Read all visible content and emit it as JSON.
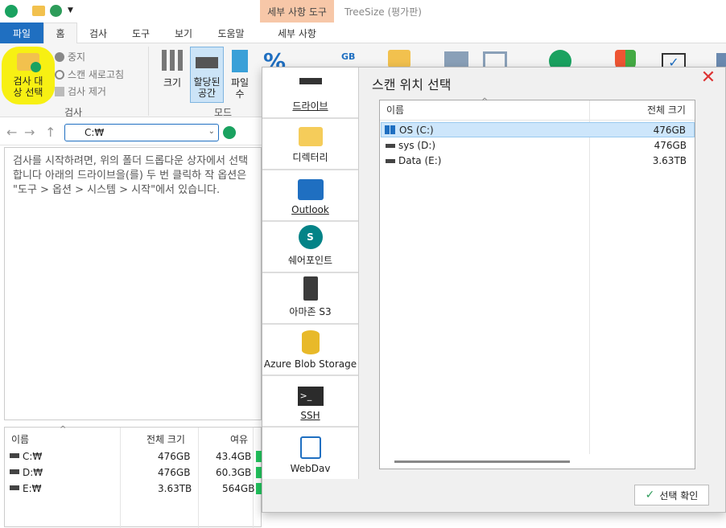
{
  "app": {
    "title": "TreeSize  (평가판)",
    "context_header": "세부 사항 도구"
  },
  "tabs": [
    "파일",
    "홈",
    "검사",
    "도구",
    "보기",
    "도움말",
    "세부 사항"
  ],
  "ribbon": {
    "select_target": "검사 대상 선택",
    "stop": "중지",
    "rescan": "스캔 새로고침",
    "remove": "검사 제거",
    "group_scan": "검사",
    "size": "크기",
    "allocated": "할당된 공간",
    "files": "파일 수",
    "group_mode": "모드",
    "gb": "GB"
  },
  "address": {
    "path": "C:₩"
  },
  "info_text": "검사를 시작하려면, 위의 폴더 드롭다운 상자에서 선택합니다 아래의 드라이브을(를) 두 번 클릭하 작 옵션은 \"도구 > 옵션 > 시스템 > 시작\"에서 있습니다.",
  "drive_list": {
    "headers": [
      "이름",
      "전체 크기",
      "여유"
    ],
    "rows": [
      {
        "name": "C:₩",
        "total": "476GB",
        "free": "43.4GB"
      },
      {
        "name": "D:₩",
        "total": "476GB",
        "free": "60.3GB"
      },
      {
        "name": "E:₩",
        "total": "3.63TB",
        "free": "564GB"
      }
    ]
  },
  "dialog": {
    "title": "스캔 위치 선택",
    "sources": [
      "드라이브",
      "디렉터리",
      "Outlook",
      "쉐어포인트",
      "아마존 S3",
      "Azure Blob Storage",
      "SSH",
      "WebDav"
    ],
    "headers": [
      "이름",
      "전체 크기"
    ],
    "rows": [
      {
        "name": "OS (C:)",
        "total": "476GB"
      },
      {
        "name": "sys (D:)",
        "total": "476GB"
      },
      {
        "name": "Data (E:)",
        "total": "3.63TB"
      }
    ],
    "ok": "선택 확인"
  }
}
